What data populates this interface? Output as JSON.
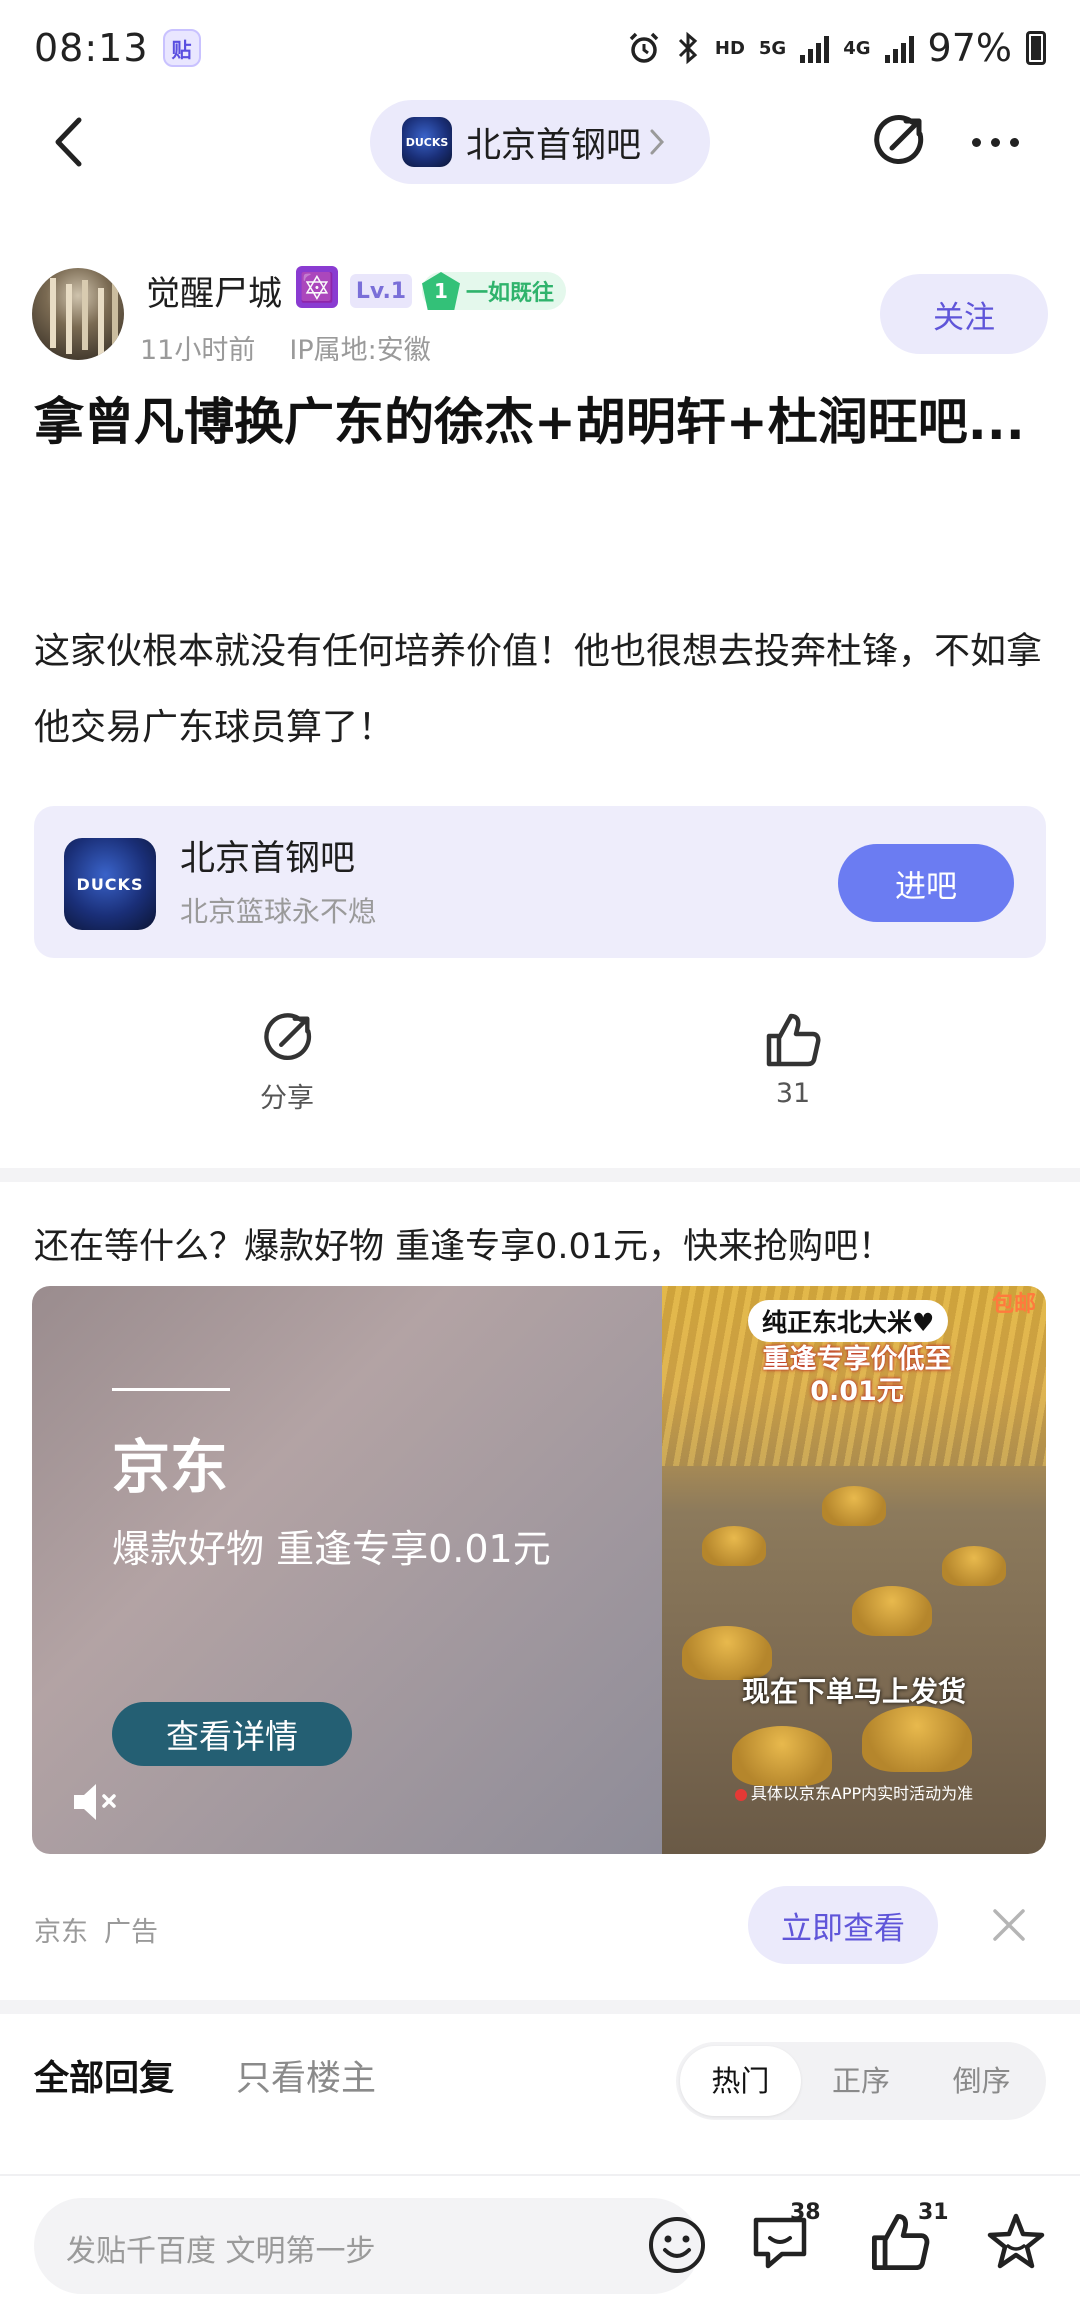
{
  "status_bar": {
    "time": "08:13",
    "app_icon_glyph": "贴",
    "network_hd": "HD",
    "network_5g": "5G",
    "network_4g": "4G",
    "battery": "97%"
  },
  "nav": {
    "forum_name": "北京首钢吧",
    "forum_logo_text": "DUCKS"
  },
  "author": {
    "name": "觉醒尸城",
    "emoji": "🔯",
    "level": "Lv.1",
    "medal_number": "1",
    "medal_text": "一如既往",
    "time": "11小时前",
    "ip": "IP属地:安徽",
    "follow_label": "关注"
  },
  "post": {
    "title": "拿曾凡博换广东的徐杰+胡明轩+杜润旺吧...",
    "body": "这家伙根本就没有任何培养价值！他也很想去投奔杜锋，不如拿他交易广东球员算了！"
  },
  "forum_card": {
    "name": "北京首钢吧",
    "description": "北京篮球永不熄",
    "logo_text": "DUCKS",
    "enter_label": "进吧"
  },
  "actions": {
    "share_label": "分享",
    "like_count": "31"
  },
  "ad": {
    "headline": "还在等什么？爆款好物 重逢专享0.01元，快来抢购吧！",
    "brand": "京东",
    "slogan": "爆款好物 重逢专享0.01元",
    "detail_button": "查看详情",
    "tag1": "纯正东北大米♥",
    "tag_corner": "包邮",
    "price_line1": "重逢专享价低至",
    "price_line2": "0.01元",
    "cta_text": "现在下单马上发货",
    "note": "具体以京东APP内实时活动为准",
    "advertiser": "京东",
    "ad_label": "广告",
    "view_now": "立即查看"
  },
  "replies": {
    "tab_all": "全部回复",
    "tab_op_only": "只看楼主",
    "sort_hot": "热门",
    "sort_asc": "正序",
    "sort_desc": "倒序"
  },
  "bottom_bar": {
    "input_placeholder": "发贴千百度 文明第一步",
    "comment_count": "38",
    "like_count": "31"
  }
}
